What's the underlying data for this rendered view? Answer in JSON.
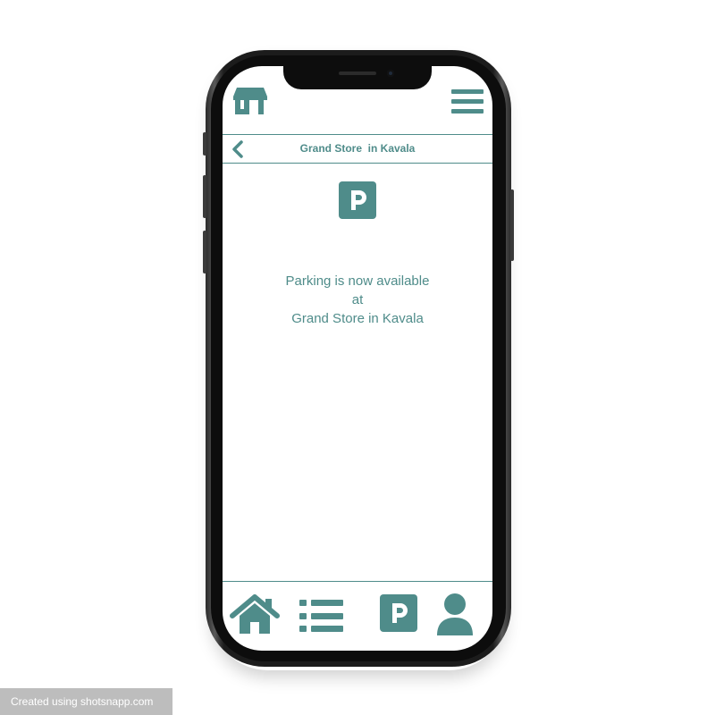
{
  "colors": {
    "accent": "#4f8c8a",
    "background": "#ffffff",
    "device": "#1c1c1c"
  },
  "top_bar": {
    "store_icon": "store-icon",
    "menu_icon": "hamburger-menu-icon"
  },
  "header": {
    "back_icon": "chevron-left-icon",
    "title": "Grand Store  in Kavala"
  },
  "main": {
    "parking_icon": "parking-icon",
    "message_lines": [
      "Parking is now available",
      "at",
      "Grand Store in Kavala"
    ]
  },
  "bottom_nav": {
    "items": [
      {
        "icon": "home-icon"
      },
      {
        "icon": "list-icon"
      },
      {
        "icon": "parking-icon"
      },
      {
        "icon": "user-icon"
      }
    ]
  },
  "footer": {
    "credit": "Created using shotsnapp.com"
  }
}
